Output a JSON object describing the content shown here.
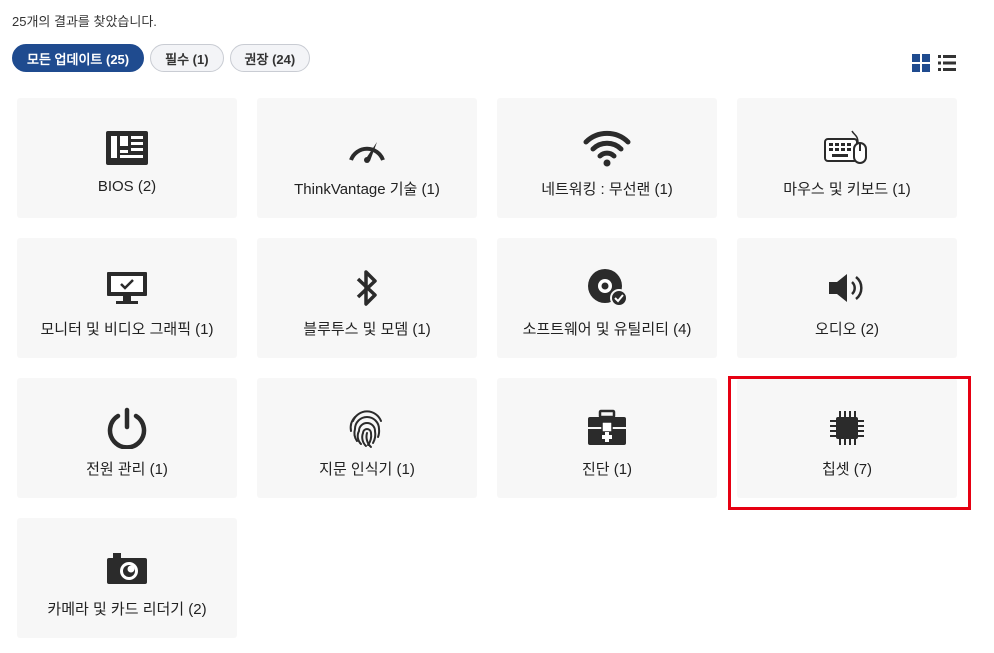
{
  "results_text": "25개의 결과를 찾았습니다.",
  "filters": [
    {
      "label": "모든 업데이트 (25)",
      "active": true
    },
    {
      "label": "필수 (1)",
      "active": false
    },
    {
      "label": "권장 (24)",
      "active": false
    }
  ],
  "view_toggle": {
    "grid_icon": "grid-view-icon",
    "list_icon": "list-view-icon"
  },
  "categories": [
    {
      "label": "BIOS (2)",
      "icon": "motherboard-icon"
    },
    {
      "label": "ThinkVantage 기술 (1)",
      "icon": "speedometer-icon"
    },
    {
      "label": "네트워킹 : 무선랜 (1)",
      "icon": "wifi-icon"
    },
    {
      "label": "마우스 및 키보드 (1)",
      "icon": "keyboard-mouse-icon"
    },
    {
      "label": "모니터 및 비디오 그래픽 (1)",
      "icon": "monitor-icon"
    },
    {
      "label": "블루투스 및 모뎀 (1)",
      "icon": "bluetooth-icon"
    },
    {
      "label": "소프트웨어 및 유틸리티 (4)",
      "icon": "disc-check-icon"
    },
    {
      "label": "오디오 (2)",
      "icon": "speaker-icon"
    },
    {
      "label": "전원 관리 (1)",
      "icon": "power-icon"
    },
    {
      "label": "지문 인식기 (1)",
      "icon": "fingerprint-icon"
    },
    {
      "label": "진단 (1)",
      "icon": "toolbox-icon"
    },
    {
      "label": "칩셋 (7)",
      "icon": "chip-icon"
    },
    {
      "label": "카메라 및 카드 리더기 (2)",
      "icon": "camera-icon"
    }
  ],
  "highlight_color": "#e60012",
  "accent_color": "#1f4b8f"
}
